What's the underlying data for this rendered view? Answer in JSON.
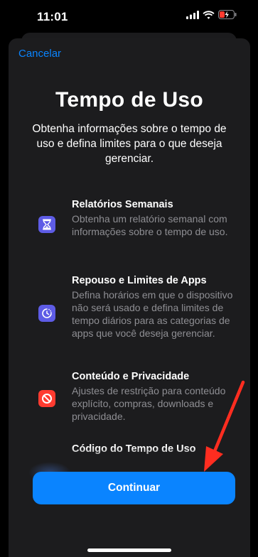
{
  "status_bar": {
    "time": "11:01",
    "icons": [
      "cellular-signal-icon",
      "wifi-icon",
      "battery-charging-icon"
    ],
    "battery_color": "#ff3b30"
  },
  "nav": {
    "cancel_label": "Cancelar"
  },
  "header": {
    "title": "Tempo de Uso",
    "subtitle": "Obtenha informações sobre o tempo de uso e defina limites para o que deseja gerenciar."
  },
  "features": [
    {
      "icon": "hourglass-icon",
      "icon_color": "#5e5ce6",
      "title": "Relatórios Semanais",
      "description": "Obtenha um relatório semanal com informações sobre o tempo de uso."
    },
    {
      "icon": "downtime-timer-icon",
      "icon_color": "#5e5ce6",
      "title": "Repouso e Limites de Apps",
      "description": "Defina horários em que o dispositivo não será usado e defina limites de tempo diários para as categorias de apps que você deseja gerenciar."
    },
    {
      "icon": "restriction-icon",
      "icon_color": "#ff3b30",
      "title": "Conteúdo e Privacidade",
      "description": "Ajustes de restrição para conteúdo explícito, compras, downloads e privacidade."
    },
    {
      "icon": "",
      "icon_color": "",
      "title": "Código do Tempo de Uso",
      "description": ""
    }
  ],
  "actions": {
    "continue_label": "Continuar"
  },
  "colors": {
    "accent": "#0a84ff",
    "annotation_arrow": "#ff2d20",
    "sheet_bg": "#1c1c1e"
  }
}
